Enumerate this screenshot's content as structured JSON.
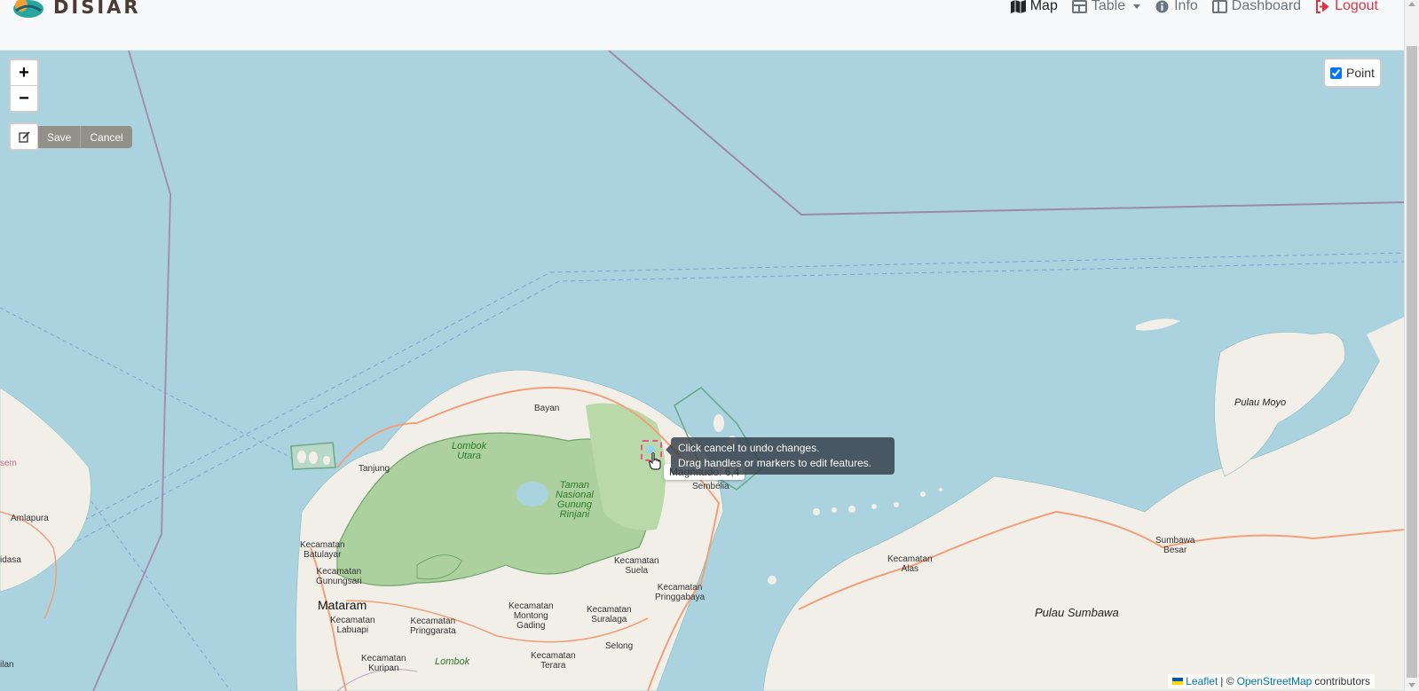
{
  "brand": {
    "name": "DISIAR"
  },
  "nav": {
    "map": "Map",
    "table": "Table",
    "info": "Info",
    "dashboard": "Dashboard",
    "logout": "Logout"
  },
  "map_controls": {
    "zoom_in": "+",
    "zoom_out": "−",
    "save": "Save",
    "cancel": "Cancel",
    "layer_point": "Point",
    "layer_point_checked": true
  },
  "tooltip": {
    "line1": "Click cancel to undo changes.",
    "line2": "Drag handles or markers to edit features."
  },
  "popup": {
    "text": "Magnitudo: 6,4"
  },
  "labels": {
    "bayan": "Bayan",
    "lombok_utara_1": "Lombok",
    "lombok_utara_2": "Utara",
    "tanjung": "Tanjung",
    "park_1": "Taman",
    "park_2": "Nasional",
    "park_3": "Gunung",
    "park_4": "Rinjani",
    "sembelia": "Sembelia",
    "batulayar_1": "Kecamatan",
    "batulayar_2": "Batulayar",
    "gunungsari_1": "Kecamatan",
    "gunungsari_2": "Gunungsari",
    "mataram": "Mataram",
    "labuapi_1": "Kecamatan",
    "labuapi_2": "Labuapi",
    "kuripan_1": "Kecamatan",
    "kuripan_2": "Kuripan",
    "narmada_1": "Kecamatan",
    "narmada_2": "Pringgarata",
    "lombok_tengah": "Lombok",
    "suela_1": "Kecamatan",
    "suela_2": "Suela",
    "pringgabaya_1": "Kecamatan",
    "pringgabaya_2": "Pringgabaya",
    "montong_1": "Kecamatan",
    "montong_2": "Montong",
    "montong_3": "Gading",
    "suralaga_1": "Kecamatan",
    "suralaga_2": "Suralaga",
    "selong": "Selong",
    "terara_1": "Kecamatan",
    "terara_2": "Terara",
    "alas_1": "Kecamatan",
    "alas_2": "Alas",
    "sumbawa_besar_1": "Sumbawa",
    "sumbawa_besar_2": "Besar",
    "pulau_sumbawa": "Pulau Sumbawa",
    "pulau_moyo": "Pulau Moyo",
    "amlapura": "Amlapura",
    "sem": "sem",
    "idasa": "idasa",
    "ilan": "ilan"
  },
  "attribution": {
    "leaflet": "Leaflet",
    "separator": "| ©",
    "osm": "OpenStreetMap",
    "contributors": "contributors"
  },
  "colors": {
    "water": "#aad3df",
    "land": "#f2efe9",
    "forest": "#add19e",
    "logout": "#dc3545"
  }
}
